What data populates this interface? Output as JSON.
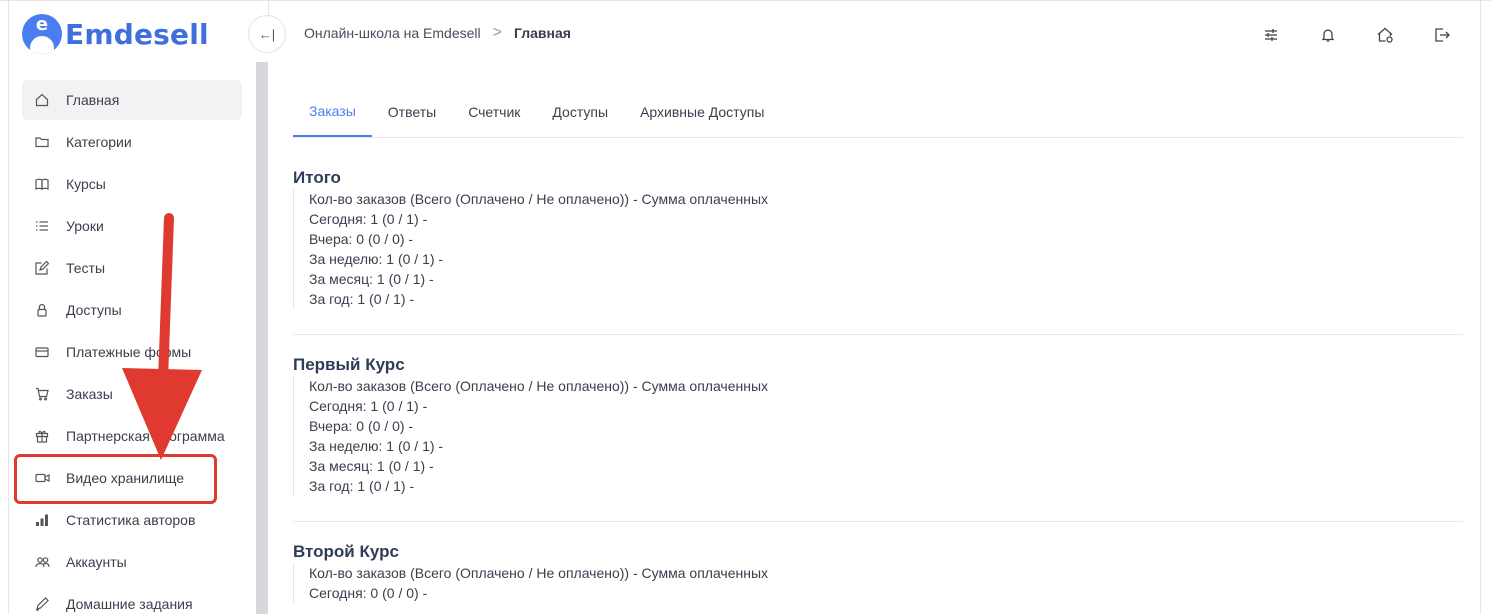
{
  "logo": {
    "letter": "e",
    "text": "Emdesell"
  },
  "header": {
    "collapse_glyph": "←|",
    "breadcrumb": [
      "Онлайн-школа на Emdesell",
      "Главная"
    ],
    "breadcrumb_separator": ">",
    "icons": [
      "settings-sliders-icon",
      "bell-icon",
      "home-settings-icon",
      "logout-icon"
    ]
  },
  "sidebar": {
    "items": [
      {
        "label": "Главная",
        "icon": "home-icon"
      },
      {
        "label": "Категории",
        "icon": "folder-icon"
      },
      {
        "label": "Курсы",
        "icon": "book-icon"
      },
      {
        "label": "Уроки",
        "icon": "list-icon"
      },
      {
        "label": "Тесты",
        "icon": "edit-icon"
      },
      {
        "label": "Доступы",
        "icon": "lock-icon"
      },
      {
        "label": "Платежные формы",
        "icon": "credit-card-icon"
      },
      {
        "label": "Заказы",
        "icon": "cart-icon"
      },
      {
        "label": "Партнерская программа",
        "icon": "gift-icon"
      },
      {
        "label": "Видео хранилище",
        "icon": "video-icon"
      },
      {
        "label": "Статистика авторов",
        "icon": "bar-chart-icon"
      },
      {
        "label": "Аккаунты",
        "icon": "users-icon"
      },
      {
        "label": "Домашние задания",
        "icon": "pen-icon"
      }
    ]
  },
  "tabs": [
    "Заказы",
    "Ответы",
    "Счетчик",
    "Доступы",
    "Архивные Доступы"
  ],
  "sections": [
    {
      "title": "Итого",
      "lines": [
        "Кол-во заказов (Всего (Оплачено / Не оплачено)) - Сумма оплаченных",
        "Сегодня: 1 (0 / 1) -",
        "Вчера: 0 (0 / 0) -",
        "За неделю: 1 (0 / 1) -",
        "За месяц: 1 (0 / 1) -",
        "За год: 1 (0 / 1) -"
      ]
    },
    {
      "title": "Первый Курс",
      "lines": [
        "Кол-во заказов (Всего (Оплачено / Не оплачено)) - Сумма оплаченных",
        "Сегодня: 1 (0 / 1) -",
        "Вчера: 0 (0 / 0) -",
        "За неделю: 1 (0 / 1) -",
        "За месяц: 1 (0 / 1) -",
        "За год: 1 (0 / 1) -"
      ]
    },
    {
      "title": "Второй Курс",
      "lines": [
        "Кол-во заказов (Всего (Оплачено / Не оплачено)) - Сумма оплаченных",
        "Сегодня: 0 (0 / 0) -"
      ]
    }
  ],
  "colors": {
    "accent": "#4a7ef0",
    "annotation": "#e0392f"
  }
}
